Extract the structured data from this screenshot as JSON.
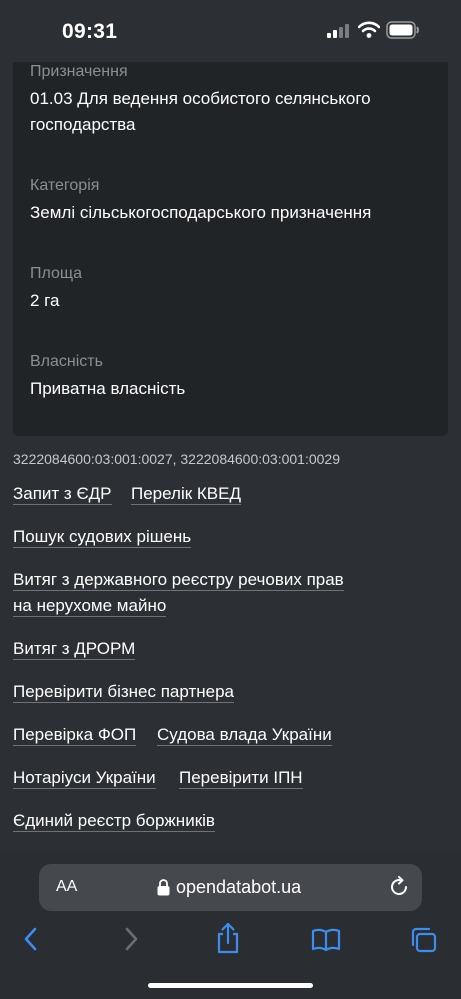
{
  "status": {
    "time": "09:31"
  },
  "details": [
    {
      "label": "Призначення",
      "value_line1": "01.03 Для ведення особистого селянського",
      "value_line2": "господарства"
    },
    {
      "label": "Категорія",
      "value_line1": "Землі сільськогосподарського призначення"
    },
    {
      "label": "Площа",
      "value_line1": "2 га"
    },
    {
      "label": "Власність",
      "value_line1": "Приватна власність"
    }
  ],
  "cadastre": {
    "number1": "3222084600:03:001:0027",
    "separator": ",",
    "number2": "3222084600:03:001:0029"
  },
  "links": {
    "edr": "Запит з ЄДР",
    "kved": "Перелік КВЕД",
    "court": "Пошук судових рішень",
    "registry_line1": "Витяг з державного реєстру речових прав",
    "registry_line2": "на нерухоме майно",
    "drorm": "Витяг з ДРОРМ",
    "partner": "Перевірити бізнес партнера",
    "fop": "Перевірка ФОП",
    "judiciary": "Судова влада України",
    "notary": "Нотаріуси України",
    "ipn": "Перевірити ІПН",
    "debtors": "Єдиний реєстр боржників"
  },
  "browser": {
    "text_size_label": "AA",
    "url": "opendatabot.ua"
  },
  "icons": {
    "back": "chevron-left-icon",
    "forward": "chevron-right-icon",
    "share": "share-icon",
    "bookmarks": "book-icon",
    "tabs": "tabs-icon",
    "reload": "reload-icon",
    "lock": "lock-icon"
  },
  "colors": {
    "background": "#2c2f33",
    "card": "#212427",
    "accent": "#3b8df0"
  }
}
